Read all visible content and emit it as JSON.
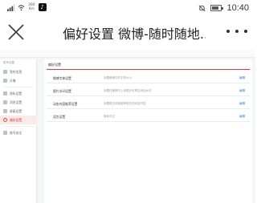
{
  "status_bar": {
    "speed_value": "390",
    "speed_unit": "K/s",
    "time": "10:40"
  },
  "app_bar": {
    "title": "偏好设置 微博-随时随地...",
    "close_icon": "close-icon",
    "more_icon": "more-dots-icon"
  },
  "sidebar": {
    "header": "账号设置",
    "items": [
      {
        "label": "我的信息",
        "icon": "user-icon"
      },
      {
        "label": "头像",
        "icon": "avatar-icon"
      },
      {
        "label": "隐私设置",
        "icon": "lock-icon"
      },
      {
        "label": "消息设置",
        "icon": "message-icon"
      },
      {
        "label": "屏蔽设置",
        "icon": "block-icon"
      },
      {
        "label": "偏好设置",
        "icon": "preference-icon",
        "active": true
      },
      {
        "label": "账号安全",
        "icon": "shield-icon"
      }
    ]
  },
  "panel": {
    "title": "偏好设置",
    "rows": [
      {
        "label": "微博字体设置",
        "desc": "设置微博中的字体大小",
        "action": "编辑"
      },
      {
        "label": "图片水印设置",
        "desc": "设置在微博中上传图片时是否添加水印",
        "action": "编辑"
      },
      {
        "label": "动态内容推荐设置",
        "desc": "设置是否向我推荐相关的动态内容",
        "action": "编辑"
      },
      {
        "label": "语言设置",
        "desc": "简体中文",
        "action": "编辑"
      }
    ]
  },
  "colors": {
    "accent_red": "#e33b3b",
    "link_blue": "#3b7bd1",
    "active_bg": "#fbeaea"
  }
}
